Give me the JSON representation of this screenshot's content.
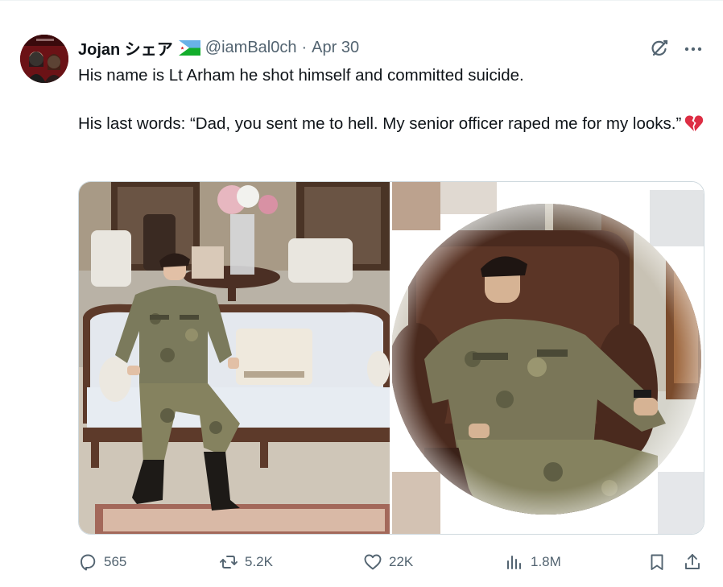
{
  "tweet": {
    "author": {
      "display_name": "Jojan シェア",
      "flag_icon": "djibouti-flag-icon",
      "handle": "@iamBal0ch",
      "separator": "·",
      "date": "Apr 30"
    },
    "text_line1": "His name is Lt Arham he shot himself and committed suicide.",
    "text_line2": "His last words: “Dad, you sent me to hell. My senior officer raped me for my looks.”",
    "emoji": "broken-heart-emoji",
    "images": [
      {
        "description_icon": "photo-soldier-on-sofa"
      },
      {
        "description_icon": "photo-soldier-in-armchair-circle"
      }
    ],
    "actions": {
      "replies": "565",
      "retweets": "5.2K",
      "likes": "22K",
      "views": "1.8M"
    },
    "icons": {
      "grok": "grok-icon",
      "more": "more-icon",
      "reply": "reply-icon",
      "retweet": "retweet-icon",
      "like": "heart-icon",
      "views": "analytics-icon",
      "bookmark": "bookmark-icon",
      "share": "share-icon"
    },
    "colors": {
      "text": "#0f1419",
      "secondary": "#536471",
      "border": "#cfd9de"
    }
  }
}
